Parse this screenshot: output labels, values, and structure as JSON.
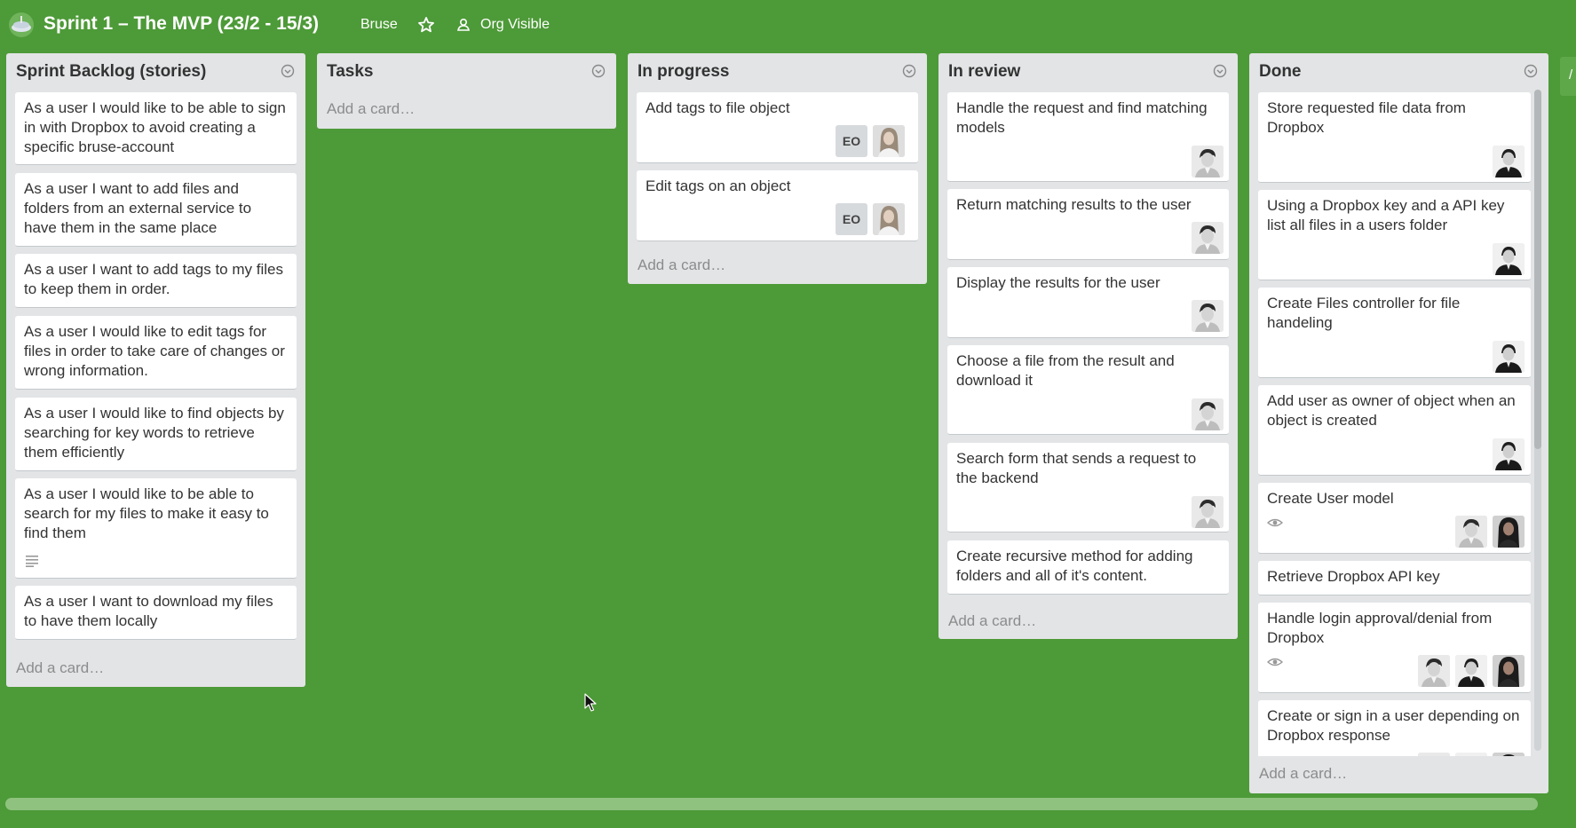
{
  "header": {
    "title": "Sprint 1 – The MVP (23/2 - 15/3)",
    "org": "Bruse",
    "visibility": "Org Visible",
    "icons": [
      "board-logo-icon",
      "star-icon",
      "org-visible-icon"
    ]
  },
  "colors": {
    "background": "#4d9a38",
    "list": "#e2e4e6",
    "card": "#ffffff"
  },
  "lists": {
    "backlog": {
      "title": "Sprint Backlog (stories)",
      "add": "Add a card…",
      "cards": [
        "As a user I would like to be able to sign in with Dropbox to avoid creating a specific bruse-account",
        "As a user I want to add files and folders from an external service to have them in the same place",
        "As a user I want to add tags to my files to keep them in order.",
        "As a user I would like to edit tags for files in order to take care of changes or wrong information.",
        "As a user I would like to find objects by searching for key words to retrieve them efficiently",
        "As a user I would like to be able to search for my files to make it easy to find them",
        "As a user I want to download my files to have them locally"
      ]
    },
    "tasks": {
      "title": "Tasks",
      "add": "Add a card…"
    },
    "inprogress": {
      "title": "In progress",
      "add": "Add a card…",
      "cards": [
        "Add tags to file object",
        "Edit tags on an object"
      ],
      "initials": "EO"
    },
    "inreview": {
      "title": "In review",
      "add": "Add a card…",
      "cards": [
        "Handle the request and find matching models",
        "Return matching results to the user",
        "Display the results for the user",
        "Choose a file from the result and download it",
        "Search form that sends a request to the backend",
        "Create recursive method for adding folders and all of it's content."
      ]
    },
    "done": {
      "title": "Done",
      "add": "Add a card…",
      "cards": [
        "Store requested file data from Dropbox",
        "Using a Dropbox key and a API key list all files in a users folder",
        "Create Files controller for file handeling",
        "Add user as owner of object when an object is created",
        "Create User model",
        "Retrieve Dropbox API key",
        "Handle login approval/denial from Dropbox",
        "Create or sign in a user depending on Dropbox response"
      ]
    }
  }
}
